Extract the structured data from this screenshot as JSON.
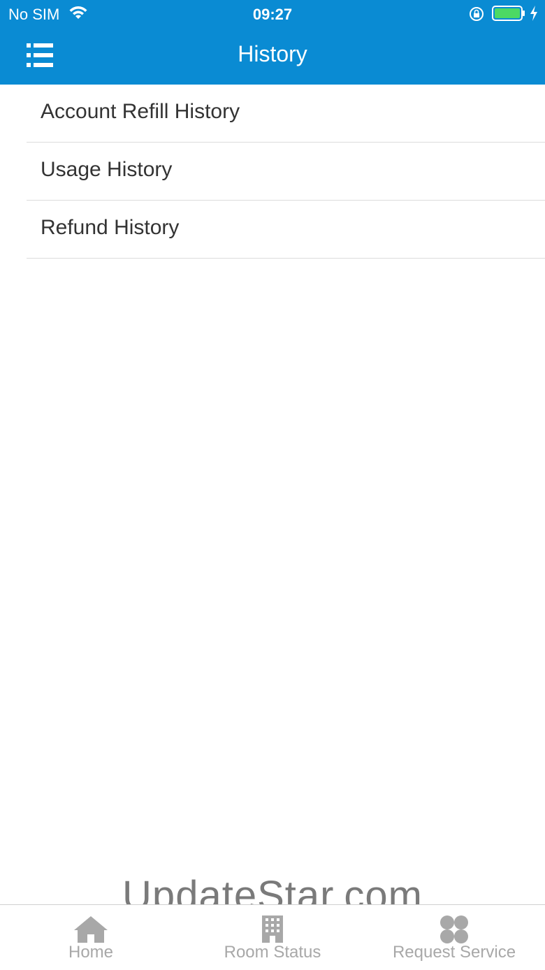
{
  "status_bar": {
    "carrier": "No SIM",
    "time": "09:27",
    "battery_color": "#4cd964"
  },
  "nav": {
    "title": "History",
    "menu_icon": "list-menu-icon"
  },
  "history_items": [
    {
      "label": "Account Refill History"
    },
    {
      "label": "Usage History"
    },
    {
      "label": "Refund History"
    }
  ],
  "watermark": "UpdateStar.com",
  "tabs": [
    {
      "label": "Home",
      "icon": "home-icon"
    },
    {
      "label": "Room Status",
      "icon": "building-icon"
    },
    {
      "label": "Request Service",
      "icon": "clover-icon"
    }
  ],
  "colors": {
    "header_bg": "#0a8bd3",
    "tab_inactive": "#a8a8a8"
  }
}
